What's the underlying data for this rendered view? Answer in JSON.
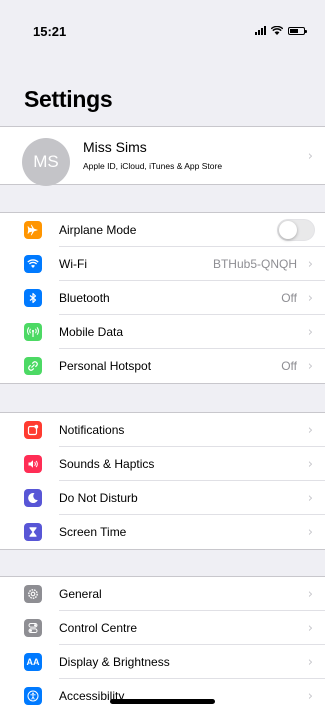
{
  "status_bar": {
    "time": "15:21"
  },
  "page_title": "Settings",
  "profile": {
    "initials": "MS",
    "name": "Miss Sims",
    "subtitle": "Apple ID, iCloud, iTunes & App Store"
  },
  "groups": [
    {
      "items": [
        {
          "label": "Airplane Mode",
          "icon": "airplane-icon",
          "color": "#ff9500",
          "control": "toggle",
          "on": false
        },
        {
          "label": "Wi-Fi",
          "icon": "wifi-icon",
          "color": "#007aff",
          "value": "BTHub5-QNQH"
        },
        {
          "label": "Bluetooth",
          "icon": "bluetooth-icon",
          "color": "#007aff",
          "value": "Off"
        },
        {
          "label": "Mobile Data",
          "icon": "antenna-icon",
          "color": "#4cd964"
        },
        {
          "label": "Personal Hotspot",
          "icon": "hotspot-icon",
          "color": "#4cd964",
          "value": "Off"
        }
      ]
    },
    {
      "items": [
        {
          "label": "Notifications",
          "icon": "notifications-icon",
          "color": "#ff3b30"
        },
        {
          "label": "Sounds & Haptics",
          "icon": "speaker-icon",
          "color": "#ff2d55"
        },
        {
          "label": "Do Not Disturb",
          "icon": "moon-icon",
          "color": "#5856d6"
        },
        {
          "label": "Screen Time",
          "icon": "hourglass-icon",
          "color": "#5856d6"
        }
      ]
    },
    {
      "items": [
        {
          "label": "General",
          "icon": "gear-icon",
          "color": "#8e8e93"
        },
        {
          "label": "Control Centre",
          "icon": "switches-icon",
          "color": "#8e8e93"
        },
        {
          "label": "Display & Brightness",
          "icon": "aa-icon",
          "color": "#007aff",
          "glyph": "AA"
        },
        {
          "label": "Accessibility",
          "icon": "accessibility-icon",
          "color": "#007aff"
        }
      ]
    }
  ]
}
